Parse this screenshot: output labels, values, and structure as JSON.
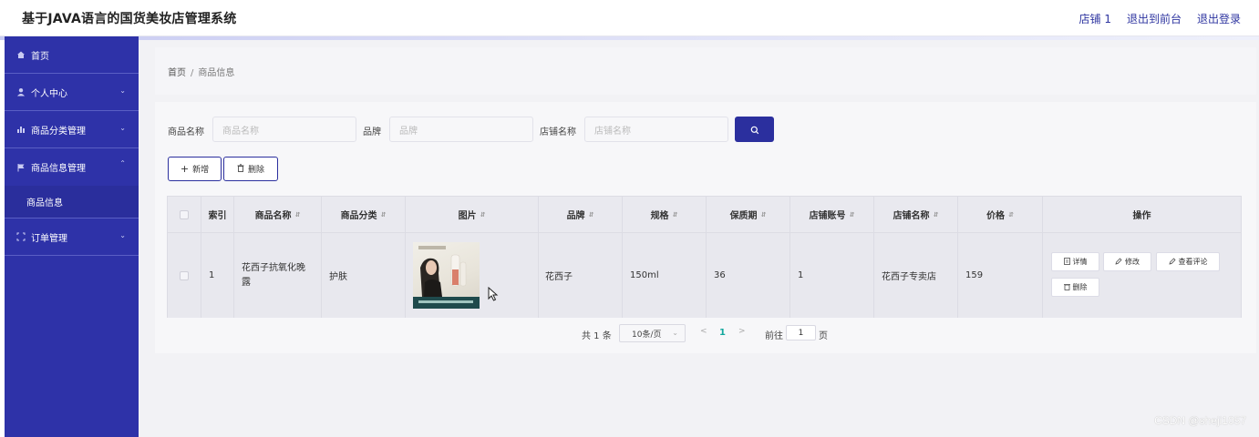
{
  "header": {
    "title": "基于JAVA语言的国货美妆店管理系统",
    "links": [
      "店铺 1",
      "退出到前台",
      "退出登录"
    ]
  },
  "sidebar": {
    "items": [
      {
        "label": "首页",
        "icon": "home-icon"
      },
      {
        "label": "个人中心",
        "icon": "user-icon",
        "expanded": false
      },
      {
        "label": "商品分类管理",
        "icon": "bar-chart-icon",
        "expanded": false
      },
      {
        "label": "商品信息管理",
        "icon": "flag-icon",
        "expanded": true
      },
      {
        "label": "订单管理",
        "icon": "frame-icon",
        "expanded": false
      }
    ],
    "submenu": {
      "label": "商品信息"
    }
  },
  "breadcrumb": {
    "home": "首页",
    "separator": "/",
    "current": "商品信息"
  },
  "search": {
    "fields": [
      {
        "label": "商品名称",
        "placeholder": "商品名称"
      },
      {
        "label": "品牌",
        "placeholder": "品牌"
      },
      {
        "label": "店铺名称",
        "placeholder": "店铺名称"
      }
    ],
    "button_icon": "search-icon"
  },
  "toolbar": {
    "add_label": "新增",
    "delete_label": "删除"
  },
  "table": {
    "columns": [
      "索引",
      "商品名称",
      "商品分类",
      "图片",
      "品牌",
      "规格",
      "保质期",
      "店铺账号",
      "店铺名称",
      "价格",
      "操作"
    ],
    "rows": [
      {
        "index": "1",
        "name": "花西子抗氧化晚露",
        "category": "护肤",
        "brand": "花西子",
        "spec": "150ml",
        "shelf_life": "36",
        "shop_account": "1",
        "shop_name": "花西子专卖店",
        "price": "159"
      }
    ],
    "actions": {
      "detail": "详情",
      "edit": "修改",
      "review": "查看评论",
      "delete": "删除"
    }
  },
  "pagination": {
    "total": "共 1 条",
    "page_size": "10条/页",
    "current_page": "1",
    "goto_label": "前往",
    "goto_value": "1",
    "page_suffix": "页"
  },
  "watermark": "CSDN @sheji1057",
  "colors": {
    "primary": "#2b2f9e",
    "sidebar": "#2e32a8",
    "active_page": "#13a89e"
  }
}
